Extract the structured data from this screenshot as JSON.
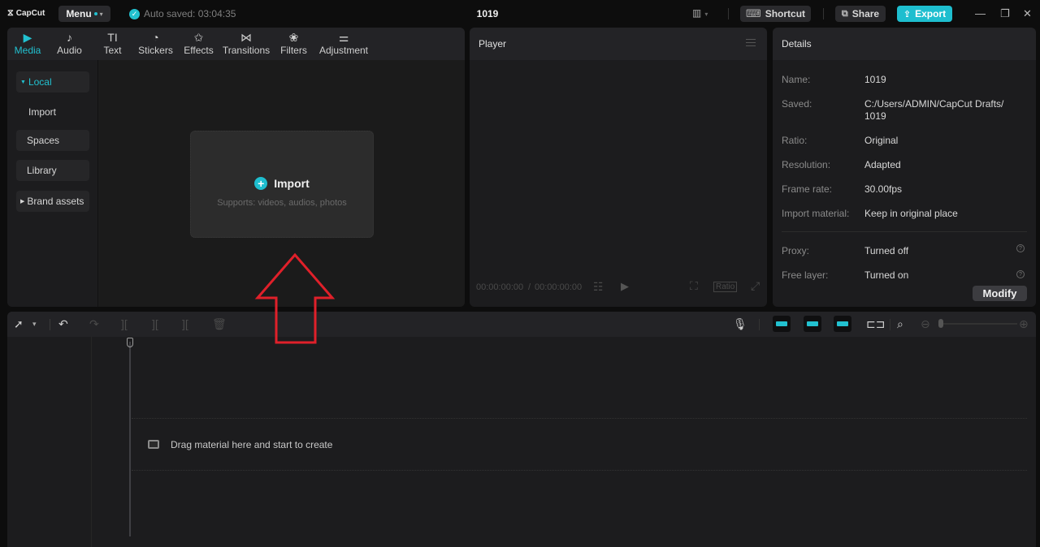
{
  "titlebar": {
    "app_name": "CapCut",
    "menu_label": "Menu",
    "autosave_text": "Auto saved: 03:04:35",
    "project_title": "1019",
    "shortcut_label": "Shortcut",
    "share_label": "Share",
    "export_label": "Export",
    "window_controls": {
      "minimize": "—",
      "restore": "❐",
      "close": "✕"
    }
  },
  "media_tabs": [
    {
      "label": "Media",
      "icon": "media-icon",
      "glyph": "▶",
      "active": true
    },
    {
      "label": "Audio",
      "icon": "audio-icon",
      "glyph": "♪"
    },
    {
      "label": "Text",
      "icon": "text-icon",
      "glyph": "TI"
    },
    {
      "label": "Stickers",
      "icon": "sticker-icon",
      "glyph": "◔"
    },
    {
      "label": "Effects",
      "icon": "effects-icon",
      "glyph": "✩"
    },
    {
      "label": "Transitions",
      "icon": "transitions-icon",
      "glyph": "⋈"
    },
    {
      "label": "Filters",
      "icon": "filters-icon",
      "glyph": "❀"
    },
    {
      "label": "Adjustment",
      "icon": "adjustment-icon",
      "glyph": "⚌"
    }
  ],
  "sidebar": {
    "items": [
      {
        "label": "Local",
        "caret": "▼",
        "active": true
      },
      {
        "label": "Import"
      },
      {
        "label": "Spaces"
      },
      {
        "label": "Library"
      },
      {
        "label": "Brand assets",
        "caret": "▶"
      }
    ]
  },
  "import_card": {
    "label": "Import",
    "subtitle": "Supports: videos, audios, photos"
  },
  "player": {
    "title": "Player",
    "current_time": "00:00:00:00",
    "separator": "/",
    "total_time": "00:00:00:00",
    "ratio_label": "Ratio"
  },
  "details": {
    "title": "Details",
    "rows": [
      {
        "label": "Name:",
        "value": "1019"
      },
      {
        "label": "Saved:",
        "value": "C:/Users/ADMIN/CapCut Drafts/ 1019"
      },
      {
        "label": "Ratio:",
        "value": "Original"
      },
      {
        "label": "Resolution:",
        "value": "Adapted"
      },
      {
        "label": "Frame rate:",
        "value": "30.00fps"
      },
      {
        "label": "Import material:",
        "value": "Keep in original place"
      },
      {
        "label": "Proxy:",
        "value": "Turned off"
      },
      {
        "label": "Free layer:",
        "value": "Turned on"
      }
    ],
    "modify_label": "Modify"
  },
  "timeline": {
    "drop_hint": "Drag material here and start to create"
  },
  "colors": {
    "accent": "#1ebecf",
    "annotation": "#e0202a",
    "background": "#0d0d0d",
    "panel": "#1c1c1e"
  }
}
